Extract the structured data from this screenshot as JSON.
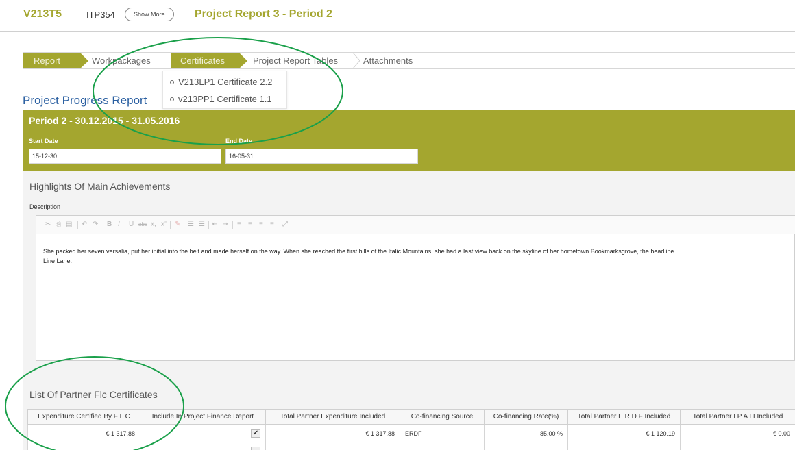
{
  "header": {
    "project_code": "V213T5",
    "itp_code": "ITP354",
    "show_more_label": "Show More",
    "report_title": "Project Report 3 - Period 2"
  },
  "steps": [
    {
      "label": "Report",
      "active": true
    },
    {
      "label": "Workpackages",
      "active": false
    },
    {
      "label": "Certificates",
      "active": true
    },
    {
      "label": "Project Report Tables",
      "active": false
    },
    {
      "label": "Attachments",
      "active": false
    }
  ],
  "certificates_menu": {
    "items": [
      "V213LP1 Certificate 2.2",
      "v213PP1 Certificate 1.1"
    ]
  },
  "progress": {
    "section_title": "Project Progress Report",
    "period_heading": "Period 2 - 30.12.2015 - 31.05.2016",
    "start_date_label": "Start Date",
    "start_date_value": "15-12-30",
    "end_date_label": "End Date",
    "end_date_value": "16-05-31"
  },
  "highlights": {
    "title": "Highlights Of Main Achievements",
    "description_label": "Description",
    "editor_line1": "She packed her seven versalia, put her initial into the belt and made herself on the way. When she reached the first hills of the Italic Mountains, she had a last view back on the skyline of her hometown Bookmarksgrove, the headline",
    "editor_line2": "Line Lane."
  },
  "certificates_table": {
    "title": "List Of Partner Flc Certificates",
    "headers": [
      "Expenditure Certified By F L C",
      "Include In Project Finance Report",
      "Total Partner Expenditure Included",
      "Co-financing Source",
      "Co-financing Rate(%)",
      "Total Partner E R D F Included",
      "Total Partner I P A I I Included"
    ],
    "row1": {
      "expenditure": "€ 1 317.88",
      "include_check": "✔",
      "total_expenditure": "€ 1 317.88",
      "source": "ERDF",
      "rate": "85.00 %",
      "erdf": "€ 1 120.19",
      "ipa": "€ 0.00"
    }
  },
  "colors": {
    "accent_olive": "#a4a62f",
    "title_blue": "#2a5fa1",
    "annotation_green": "#1aa04a"
  },
  "icons": [
    "cut-icon",
    "copy-icon",
    "paste-icon",
    "undo-icon",
    "redo-icon",
    "bold-icon",
    "italic-icon",
    "underline-icon",
    "strikethrough-icon",
    "subscript-icon",
    "superscript-icon",
    "remove-format-icon",
    "numbered-list-icon",
    "bulleted-list-icon",
    "outdent-icon",
    "indent-icon",
    "align-left-icon",
    "align-center-icon",
    "align-right-icon",
    "justify-icon",
    "maximize-icon",
    "checkmark-icon"
  ]
}
